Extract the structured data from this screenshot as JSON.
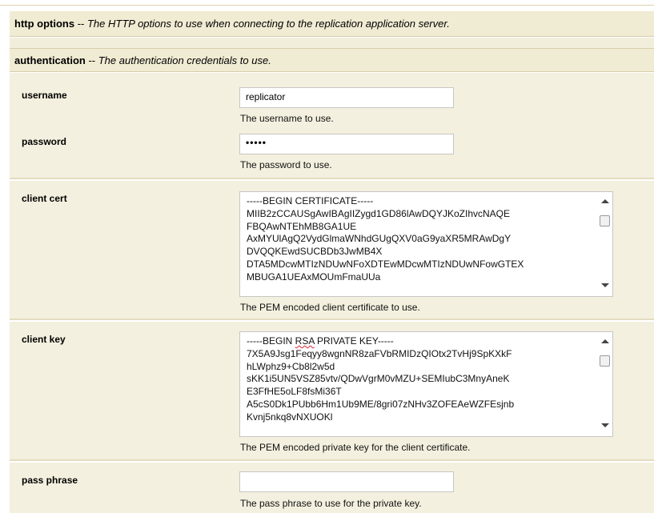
{
  "http_options": {
    "title": "http options",
    "separator": " -- ",
    "description": "The HTTP options to use when connecting to the replication application server."
  },
  "authentication": {
    "title": "authentication",
    "separator": " -- ",
    "description": "The authentication credentials to use."
  },
  "fields": {
    "username": {
      "label": "username",
      "value": "replicator",
      "help": "The username to use."
    },
    "password": {
      "label": "password",
      "value": "•••••",
      "help": "The password to use."
    },
    "client_cert": {
      "label": "client cert",
      "lines": [
        "-----BEGIN CERTIFICATE-----",
        "MIIB2zCCAUSgAwIBAgIIZygd1GD86lAwDQYJKoZIhvcNAQE",
        "FBQAwNTEhMB8GA1UE",
        "AxMYUlAgQ2VydGlmaWNhdGUgQXV0aG9yaXR5MRAwDgY",
        "DVQQKEwdSUCBDb3JwMB4X",
        "DTA5MDcwMTIzNDUwNFoXDTEwMDcwMTIzNDUwNFowGTEX",
        "MBUGA1UEAxMOUmFmaUUa"
      ],
      "help": "The PEM encoded client certificate to use."
    },
    "client_key": {
      "label": "client key",
      "line0_prefix": "-----BEGIN ",
      "line0_word": "RSA",
      "line0_suffix": " PRIVATE KEY-----",
      "lines": [
        "7X5A9Jsg1Feqyy8wgnNR8zaFVbRMIDzQIOtx2TvHj9SpKXkF",
        "hLWphz9+Cb8l2w5d",
        "sKK1i5UN5VSZ85vtv/QDwVgrM0vMZU+SEMIubC3MnyAneK",
        "E3FfHE5oLF8fsMi36T",
        "A5cS0Dk1PUbb6Hm1Ub9ME/8gri07zNHv3ZOFEAeWZFEsjnb",
        "Kvnj5nkq8vNXUOKl"
      ],
      "help": "The PEM encoded private key for the client certificate."
    },
    "pass_phrase": {
      "label": "pass phrase",
      "value": "",
      "help": "The pass phrase to use for the private key."
    }
  }
}
